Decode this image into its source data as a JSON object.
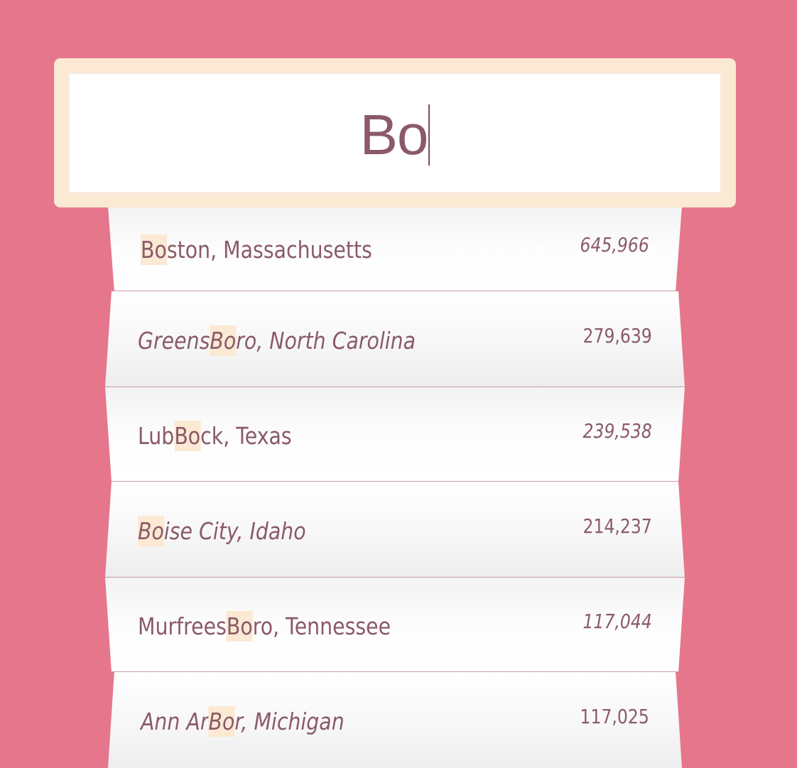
{
  "search": {
    "value": "Bo"
  },
  "results": [
    {
      "before": "",
      "match": "Bo",
      "after": "ston, Massachusetts",
      "population": "645,966",
      "city_italic": false,
      "pop_italic": true
    },
    {
      "before": "Greens",
      "match": "Bo",
      "after": "ro, North Carolina",
      "population": "279,639",
      "city_italic": true,
      "pop_italic": false
    },
    {
      "before": "Lub",
      "match": "Bo",
      "after": "ck, Texas",
      "population": "239,538",
      "city_italic": false,
      "pop_italic": true
    },
    {
      "before": "",
      "match": "Bo",
      "after": "ise City, Idaho",
      "population": "214,237",
      "city_italic": true,
      "pop_italic": false
    },
    {
      "before": "Murfrees",
      "match": "Bo",
      "after": "ro, Tennessee",
      "population": "117,044",
      "city_italic": false,
      "pop_italic": true
    },
    {
      "before": "Ann Ar",
      "match": "Bo",
      "after": "r, Michigan",
      "population": "117,025",
      "city_italic": true,
      "pop_italic": false
    }
  ],
  "colors": {
    "background": "#e6768c",
    "frame": "#fbe9d3",
    "text": "#8a5a68",
    "highlight": "#fbe9d3"
  }
}
